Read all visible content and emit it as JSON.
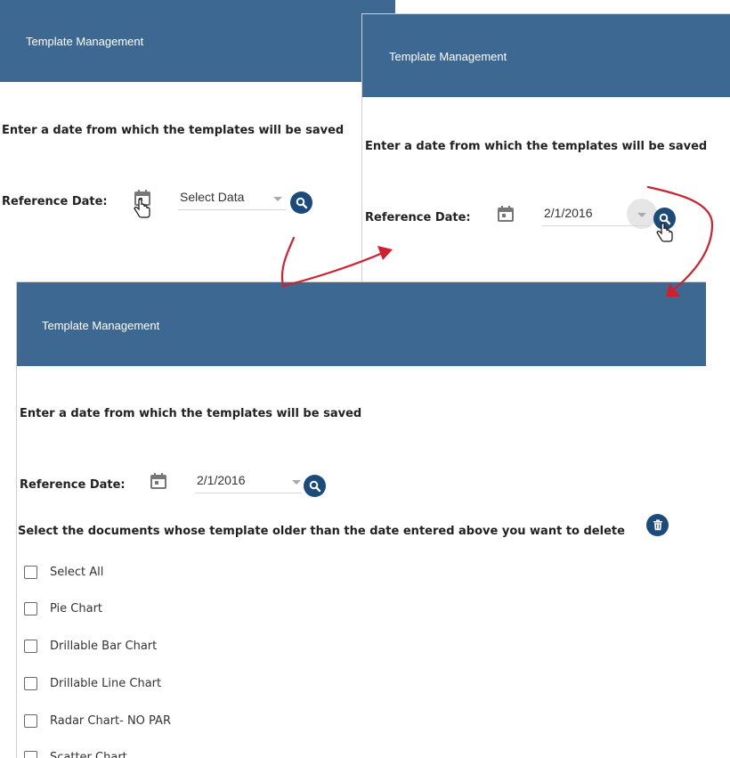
{
  "colors": {
    "header": "#3d6891",
    "button": "#1b4a7c",
    "arrow": "#d0202e"
  },
  "panel_a": {
    "header_title": "Template Management",
    "instruction": "Enter a date from which the templates will be saved",
    "reference_label": "Reference Date:",
    "date_value": "Select Data"
  },
  "panel_b": {
    "header_title": "Template Management",
    "instruction": "Enter a date from which the templates will be saved",
    "reference_label": "Reference Date:",
    "date_value": "2/1/2016"
  },
  "panel_c": {
    "header_title": "Template Management",
    "instruction": "Enter a date from which the templates will be saved",
    "reference_label": "Reference Date:",
    "date_value": "2/1/2016",
    "delete_prompt": "Select the documents whose template older than the date entered above you want to delete",
    "documents": [
      {
        "label": "Select All",
        "checked": false
      },
      {
        "label": "Pie Chart",
        "checked": false
      },
      {
        "label": "Drillable Bar Chart",
        "checked": false
      },
      {
        "label": "Drillable Line Chart",
        "checked": false
      },
      {
        "label": "Radar Chart- NO PAR",
        "checked": false
      },
      {
        "label": "Scatter Chart",
        "checked": false
      }
    ]
  },
  "icons": {
    "calendar": "calendar-icon",
    "search": "search-icon",
    "delete": "trash-icon",
    "cursor": "hand-pointer-icon"
  }
}
